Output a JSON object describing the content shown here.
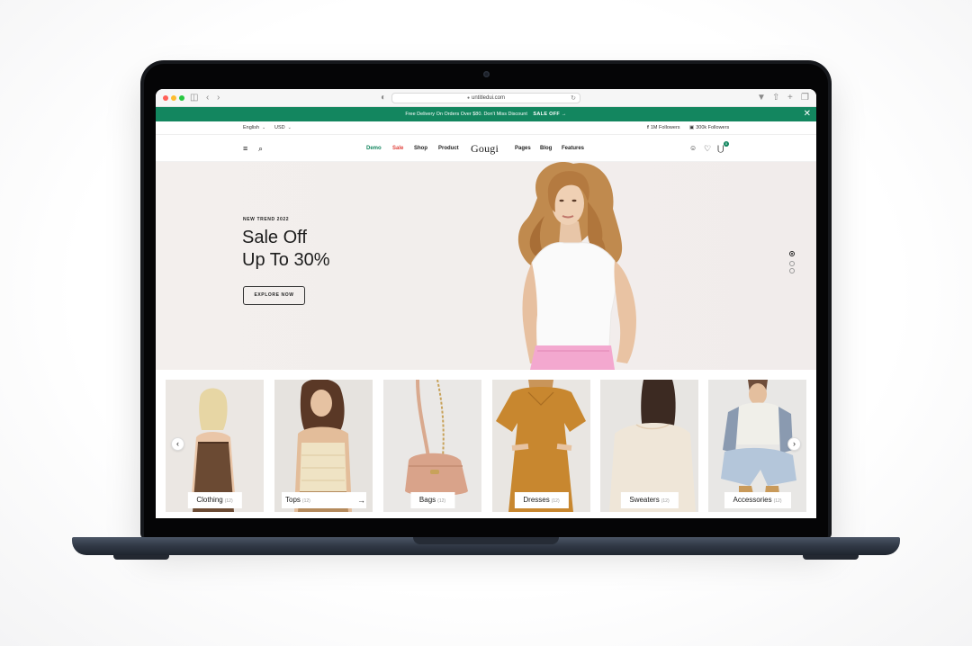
{
  "browser": {
    "url": "untitledui.com"
  },
  "promo": {
    "text": "Free Delivery On Orders Over $80. Don't Miss Discount",
    "cta": "SALE OFF →",
    "close": "✕"
  },
  "utility": {
    "language": "English",
    "currency": "USD",
    "facebook": "1M Followers",
    "instagram": "300k Followers"
  },
  "nav": {
    "links_left": [
      "Demo",
      "Sale",
      "Shop",
      "Product"
    ],
    "logo": "Gougi",
    "links_right": [
      "Pages",
      "Blog",
      "Features"
    ],
    "cart_count": "0"
  },
  "hero": {
    "kicker": "NEW TREND 2022",
    "title_line1": "Sale Off",
    "title_line2": "Up To 30%",
    "button": "EXPLORE NOW",
    "slides": 3,
    "active_slide": 1
  },
  "categories": [
    {
      "name": "Clothing",
      "count": "(12)"
    },
    {
      "name": "Tops",
      "count": "(12)"
    },
    {
      "name": "Bags",
      "count": "(12)"
    },
    {
      "name": "Dresses",
      "count": "(12)"
    },
    {
      "name": "Sweaters",
      "count": "(12)"
    },
    {
      "name": "Accessories",
      "count": "(12)"
    }
  ],
  "colors": {
    "brand_green": "#13865f",
    "sale_red": "#e0423c",
    "hero_bg": "#f2eeec"
  },
  "icons": {
    "menu": "≡",
    "search": "⌕",
    "user": "☺",
    "heart": "♡",
    "cart": "⋃",
    "prev": "‹",
    "next": "›",
    "arrow_right": "→"
  }
}
